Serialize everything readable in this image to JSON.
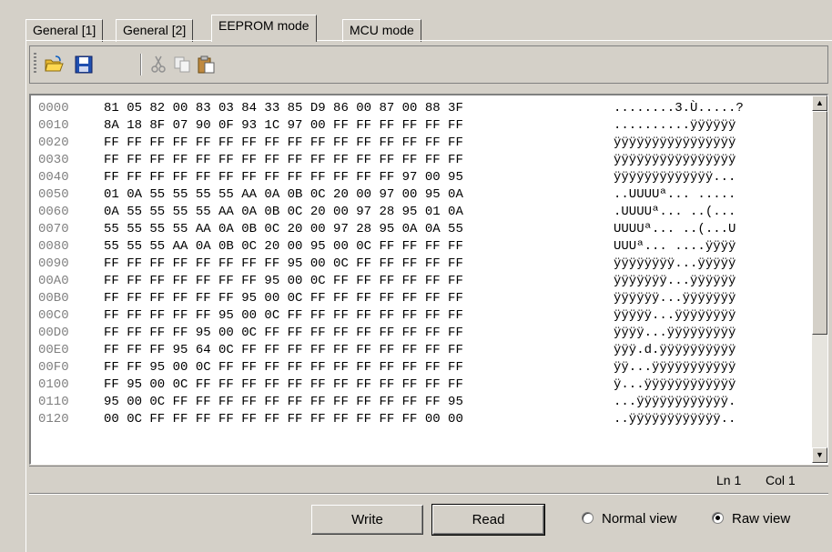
{
  "tabs": [
    "General [1]",
    "General [2]",
    "EEPROM mode",
    "MCU mode"
  ],
  "active_tab": "EEPROM mode",
  "toolbar": [
    "open-folder-icon",
    "save-disk-icon",
    "cut-scissors-icon",
    "copy-icon",
    "paste-clipboard-icon"
  ],
  "editor": {
    "rows": [
      {
        "offset": "0000",
        "hex": "81 05 82 00 83 03 84 33 85 D9 86 00 87 00 88 3F",
        "ascii": "........3.Ù.....?"
      },
      {
        "offset": "0010",
        "hex": "8A 18 8F 07 90 0F 93 1C 97 00 FF FF FF FF FF FF",
        "ascii": "..........ÿÿÿÿÿÿ"
      },
      {
        "offset": "0020",
        "hex": "FF FF FF FF FF FF FF FF FF FF FF FF FF FF FF FF",
        "ascii": "ÿÿÿÿÿÿÿÿÿÿÿÿÿÿÿÿ"
      },
      {
        "offset": "0030",
        "hex": "FF FF FF FF FF FF FF FF FF FF FF FF FF FF FF FF",
        "ascii": "ÿÿÿÿÿÿÿÿÿÿÿÿÿÿÿÿ"
      },
      {
        "offset": "0040",
        "hex": "FF FF FF FF FF FF FF FF FF FF FF FF FF 97 00 95",
        "ascii": "ÿÿÿÿÿÿÿÿÿÿÿÿÿ..."
      },
      {
        "offset": "0050",
        "hex": "01 0A 55 55 55 55 AA 0A 0B 0C 20 00 97 00 95 0A",
        "ascii": "..UUUUª... ....."
      },
      {
        "offset": "0060",
        "hex": "0A 55 55 55 55 AA 0A 0B 0C 20 00 97 28 95 01 0A",
        "ascii": ".UUUUª... ..(..."
      },
      {
        "offset": "0070",
        "hex": "55 55 55 55 AA 0A 0B 0C 20 00 97 28 95 0A 0A 55",
        "ascii": "UUUUª... ..(...U"
      },
      {
        "offset": "0080",
        "hex": "55 55 55 AA 0A 0B 0C 20 00 95 00 0C FF FF FF FF",
        "ascii": "UUUª... ....ÿÿÿÿ"
      },
      {
        "offset": "0090",
        "hex": "FF FF FF FF FF FF FF FF 95 00 0C FF FF FF FF FF",
        "ascii": "ÿÿÿÿÿÿÿÿ...ÿÿÿÿÿ"
      },
      {
        "offset": "00A0",
        "hex": "FF FF FF FF FF FF FF 95 00 0C FF FF FF FF FF FF",
        "ascii": "ÿÿÿÿÿÿÿ...ÿÿÿÿÿÿ"
      },
      {
        "offset": "00B0",
        "hex": "FF FF FF FF FF FF 95 00 0C FF FF FF FF FF FF FF",
        "ascii": "ÿÿÿÿÿÿ...ÿÿÿÿÿÿÿ"
      },
      {
        "offset": "00C0",
        "hex": "FF FF FF FF FF 95 00 0C FF FF FF FF FF FF FF FF",
        "ascii": "ÿÿÿÿÿ...ÿÿÿÿÿÿÿÿ"
      },
      {
        "offset": "00D0",
        "hex": "FF FF FF FF 95 00 0C FF FF FF FF FF FF FF FF FF",
        "ascii": "ÿÿÿÿ...ÿÿÿÿÿÿÿÿÿ"
      },
      {
        "offset": "00E0",
        "hex": "FF FF FF 95 64 0C FF FF FF FF FF FF FF FF FF FF",
        "ascii": "ÿÿÿ.d.ÿÿÿÿÿÿÿÿÿÿ"
      },
      {
        "offset": "00F0",
        "hex": "FF FF 95 00 0C FF FF FF FF FF FF FF FF FF FF FF",
        "ascii": "ÿÿ...ÿÿÿÿÿÿÿÿÿÿÿ"
      },
      {
        "offset": "0100",
        "hex": "FF 95 00 0C FF FF FF FF FF FF FF FF FF FF FF FF",
        "ascii": "ÿ...ÿÿÿÿÿÿÿÿÿÿÿÿ"
      },
      {
        "offset": "0110",
        "hex": "95 00 0C FF FF FF FF FF FF FF FF FF FF FF FF 95",
        "ascii": "...ÿÿÿÿÿÿÿÿÿÿÿÿ."
      },
      {
        "offset": "0120",
        "hex": "00 0C FF FF FF FF FF FF FF FF FF FF FF FF 00 00",
        "ascii": "..ÿÿÿÿÿÿÿÿÿÿÿÿ.."
      }
    ]
  },
  "status": {
    "line": "Ln 1",
    "col": "Col 1"
  },
  "buttons": {
    "write": "Write",
    "read": "Read"
  },
  "view": {
    "normal": "Normal view",
    "raw": "Raw view",
    "selected": "raw"
  }
}
